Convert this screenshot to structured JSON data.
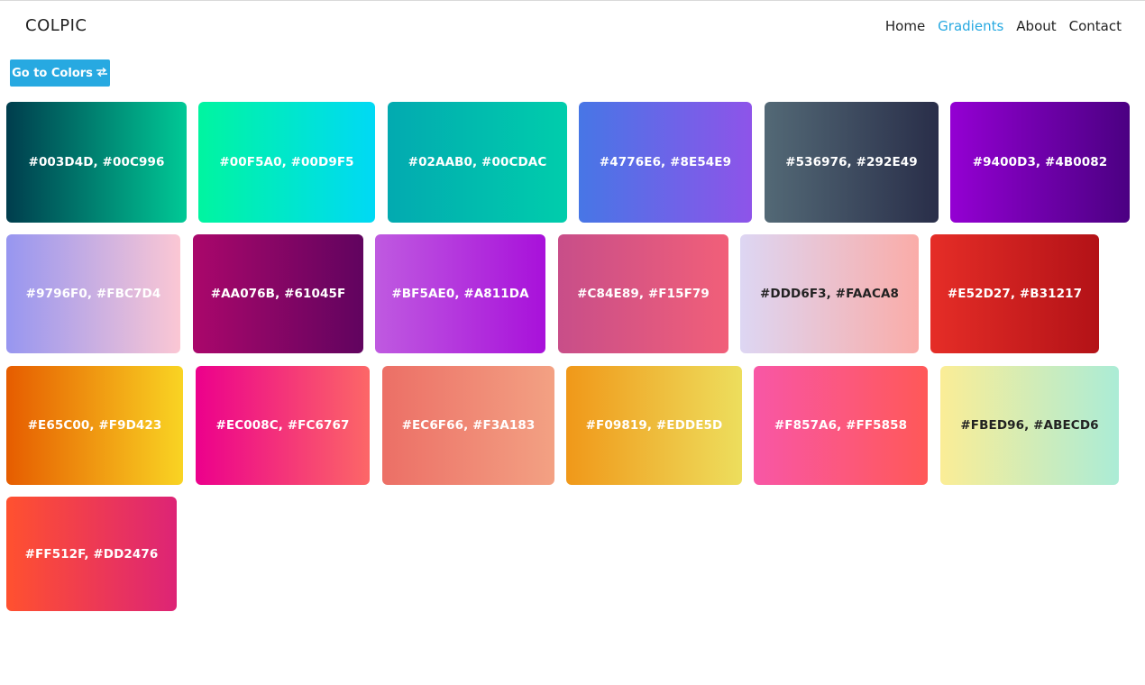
{
  "header": {
    "brand": "COLPIC",
    "nav": [
      "Home",
      "Gradients",
      "About",
      "Contact"
    ],
    "active_nav": "Gradients",
    "accent_color": "#27A9E1"
  },
  "toolbar": {
    "go_to_colors_label": "Go to Colors",
    "go_icon": "swap-arrows-icon"
  },
  "gradients": [
    {
      "label": "#003D4D, #00C996",
      "from": "#003D4D",
      "to": "#00C996",
      "text_color": "#ffffff"
    },
    {
      "label": "#00F5A0, #00D9F5",
      "from": "#00F5A0",
      "to": "#00D9F5",
      "text_color": "#ffffff"
    },
    {
      "label": "#02AAB0, #00CDAC",
      "from": "#02AAB0",
      "to": "#00CDAC",
      "text_color": "#ffffff"
    },
    {
      "label": "#4776E6, #8E54E9",
      "from": "#4776E6",
      "to": "#8E54E9",
      "text_color": "#ffffff"
    },
    {
      "label": "#536976, #292E49",
      "from": "#536976",
      "to": "#292E49",
      "text_color": "#ffffff"
    },
    {
      "label": "#9400D3, #4B0082",
      "from": "#9400D3",
      "to": "#4B0082",
      "text_color": "#ffffff"
    },
    {
      "label": "#9796F0, #FBC7D4",
      "from": "#9796F0",
      "to": "#FBC7D4",
      "text_color": "#ffffff"
    },
    {
      "label": "#AA076B, #61045F",
      "from": "#AA076B",
      "to": "#61045F",
      "text_color": "#ffffff"
    },
    {
      "label": "#BF5AE0, #A811DA",
      "from": "#BF5AE0",
      "to": "#A811DA",
      "text_color": "#ffffff"
    },
    {
      "label": "#C84E89, #F15F79",
      "from": "#C84E89",
      "to": "#F15F79",
      "text_color": "#ffffff"
    },
    {
      "label": "#DDD6F3, #FAACA8",
      "from": "#DDD6F3",
      "to": "#FAACA8",
      "text_color": "#222222"
    },
    {
      "label": "#E52D27, #B31217",
      "from": "#E52D27",
      "to": "#B31217",
      "text_color": "#ffffff"
    },
    {
      "label": "#E65C00, #F9D423",
      "from": "#E65C00",
      "to": "#F9D423",
      "text_color": "#ffffff"
    },
    {
      "label": "#EC008C, #FC6767",
      "from": "#EC008C",
      "to": "#FC6767",
      "text_color": "#ffffff"
    },
    {
      "label": "#EC6F66, #F3A183",
      "from": "#EC6F66",
      "to": "#F3A183",
      "text_color": "#ffffff"
    },
    {
      "label": "#F09819, #EDDE5D",
      "from": "#F09819",
      "to": "#EDDE5D",
      "text_color": "#ffffff"
    },
    {
      "label": "#F857A6, #FF5858",
      "from": "#F857A6",
      "to": "#FF5858",
      "text_color": "#ffffff"
    },
    {
      "label": "#FBED96, #ABECD6",
      "from": "#FBED96",
      "to": "#ABECD6",
      "text_color": "#222222"
    },
    {
      "label": "#FF512F, #DD2476",
      "from": "#FF512F",
      "to": "#DD2476",
      "text_color": "#ffffff"
    }
  ]
}
